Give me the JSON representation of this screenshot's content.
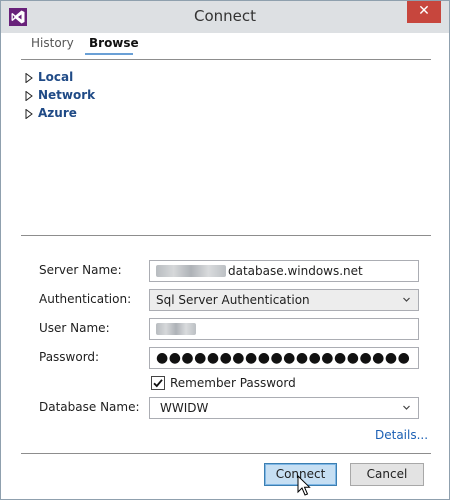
{
  "window": {
    "title": "Connect",
    "close_label": "✕",
    "app_icon": "visual-studio-icon"
  },
  "tabs": [
    {
      "label": "History"
    },
    {
      "label": "Browse",
      "selected": true
    }
  ],
  "tree": {
    "items": [
      {
        "label": "Local"
      },
      {
        "label": "Network"
      },
      {
        "label": "Azure"
      }
    ]
  },
  "form": {
    "server_name": {
      "label": "Server Name:",
      "value": "database.windows.net"
    },
    "authentication": {
      "label": "Authentication:",
      "value": "Sql Server Authentication"
    },
    "user_name": {
      "label": "User Name:"
    },
    "password": {
      "label": "Password:",
      "masked_value": "●●●●●●●●●●●●●●●●●●●●"
    },
    "remember_password": {
      "label": "Remember Password",
      "checked": true
    },
    "database_name": {
      "label": "Database Name:",
      "value": "WWIDW"
    }
  },
  "details_link": "Details...",
  "buttons": {
    "connect": "Connect",
    "cancel": "Cancel"
  },
  "colors": {
    "accent": "#6aa0d6",
    "tree_label": "#1f4a86",
    "link": "#1a5fb4",
    "close_button": "#c7463d"
  }
}
